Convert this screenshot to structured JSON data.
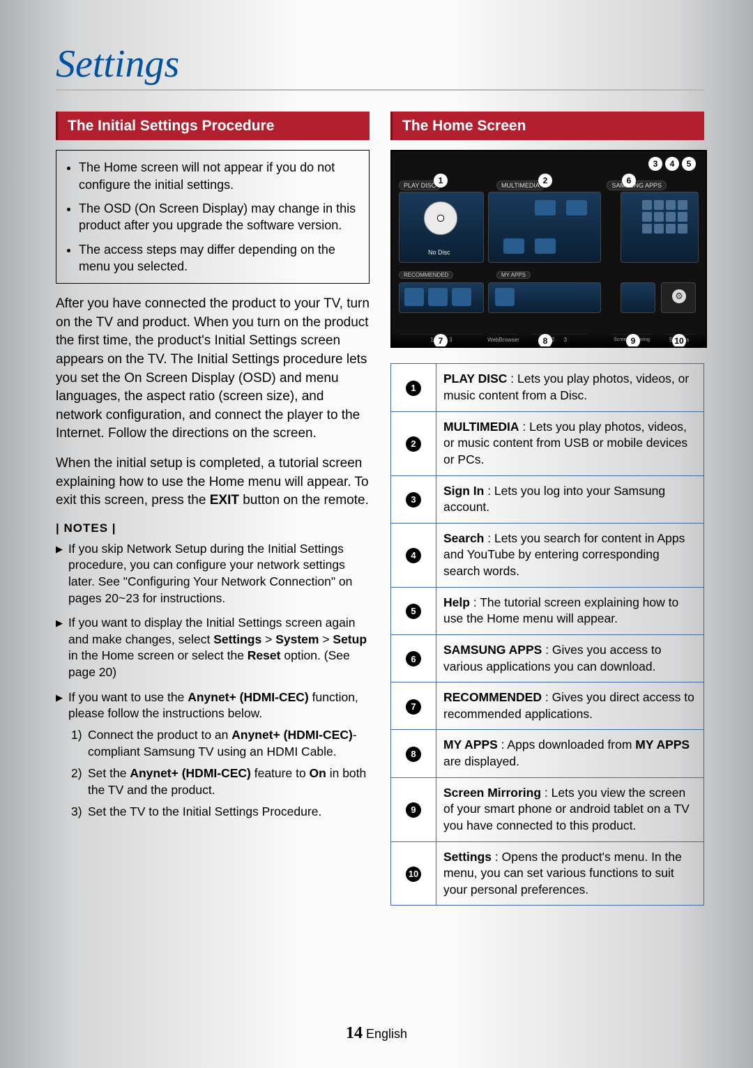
{
  "page_title": "Settings",
  "left": {
    "section_header": "The Initial Settings Procedure",
    "bullets": [
      "The Home screen will not appear if you do not configure the initial settings.",
      "The OSD (On Screen Display) may change in this product after you upgrade the software version.",
      "The access steps may differ depending on the menu you selected."
    ],
    "para1": "After you have connected the product to your TV, turn on the TV and product. When you turn on the product the first time, the product's Initial Settings screen appears on the TV. The Initial Settings procedure lets you set the On Screen Display (OSD) and menu languages, the aspect ratio (screen size), and network configuration, and connect the player to the Internet. Follow the directions on the screen.",
    "para2_pre": "When the initial setup is completed, a tutorial screen explaining how to use the Home menu will appear. To exit this screen, press the ",
    "para2_bold": "EXIT",
    "para2_post": " button on the remote.",
    "notes_label": "| NOTES |",
    "notes": [
      {
        "pre": "If you skip Network Setup during the Initial Settings procedure, you can configure your network settings later. See \"Configuring Your Network Connection\" on pages 20~23 for instructions."
      },
      {
        "pre": "If you want to display the Initial Settings screen again and make changes, select ",
        "b1": "Settings",
        "mid1": " > ",
        "b2": "System",
        "mid2": " > ",
        "b3": "Setup",
        "mid3": " in the Home screen or select the ",
        "b4": "Reset",
        "post": " option. (See page 20)"
      },
      {
        "pre": "If you want to use the ",
        "b1": "Anynet+ (HDMI-CEC)",
        "post": " function, please follow the instructions below.",
        "sub": [
          {
            "n": "1)",
            "pre": "Connect the product to an ",
            "b": "Anynet+ (HDMI-CEC)",
            "post": "-compliant Samsung TV using an HDMI Cable."
          },
          {
            "n": "2)",
            "pre": "Set the ",
            "b": "Anynet+ (HDMI-CEC)",
            "mid": " feature to ",
            "b2": "On",
            "post": " in both the TV and the product."
          },
          {
            "n": "3)",
            "pre": "Set the TV to the Initial Settings Procedure."
          }
        ]
      }
    ]
  },
  "right": {
    "section_header": "The Home Screen",
    "tv": {
      "labels": {
        "play_disc": "PLAY DISC",
        "multimedia": "MULTIMEDIA",
        "samsung_apps": "SAMSUNG APPS",
        "no_disc": "No Disc",
        "recommended": "RECOMMENDED",
        "my_apps": "MY APPS",
        "web_browser": "WebBrowser",
        "screen_mirroring": "Screen Mirroring",
        "settings": "Settings"
      }
    },
    "table": [
      {
        "n": "1",
        "b": "PLAY DISC",
        "t": " : Lets you play photos, videos, or music content from a Disc."
      },
      {
        "n": "2",
        "b": "MULTIMEDIA",
        "t": " : Lets you play photos, videos, or music content from USB or mobile devices or PCs."
      },
      {
        "n": "3",
        "b": "Sign In",
        "t": " : Lets you log into your Samsung account."
      },
      {
        "n": "4",
        "b": "Search",
        "t": " : Lets you search for content in Apps and YouTube by entering corresponding search words."
      },
      {
        "n": "5",
        "b": "Help",
        "t": " : The tutorial screen explaining how to use the Home menu will appear."
      },
      {
        "n": "6",
        "b": "SAMSUNG APPS",
        "t": " : Gives you access to various applications you can download."
      },
      {
        "n": "7",
        "b": "RECOMMENDED",
        "t": " : Gives you direct access to recommended applications."
      },
      {
        "n": "8",
        "b": "MY APPS",
        "pre": " : Apps downloaded from ",
        "b2": "MY APPS",
        "t": " are displayed."
      },
      {
        "n": "9",
        "b": "Screen Mirroring",
        "t": " : Lets you view the screen of your smart phone or android tablet on a TV you have connected to this product."
      },
      {
        "n": "10",
        "b": "Settings",
        "t": " : Opens the product's menu. In the menu, you can set various functions to suit your personal preferences."
      }
    ]
  },
  "footer": {
    "page_number": "14",
    "lang": "English"
  }
}
